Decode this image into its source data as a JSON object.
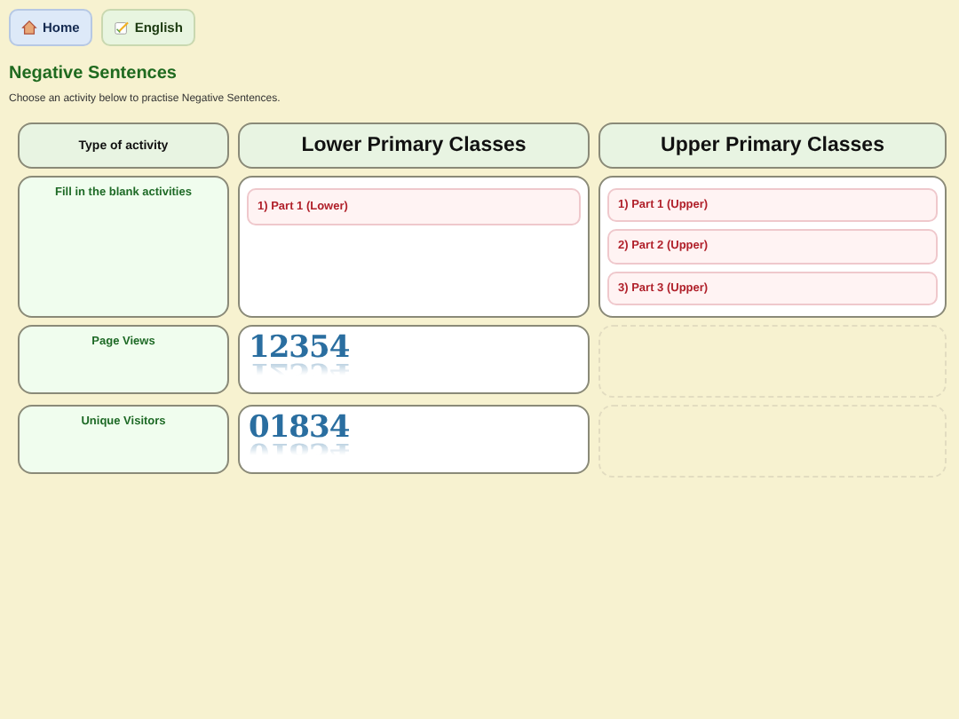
{
  "nav": [
    {
      "label": "Home",
      "kind": "home",
      "selected": true
    },
    {
      "label": "English",
      "kind": "pencil",
      "selected": false
    }
  ],
  "title": "Negative Sentences",
  "intro": "Choose an activity below to practise Negative Sentences.",
  "table": {
    "columns": [
      "Type of activity",
      "Lower Primary Classes",
      "Upper Primary Classes"
    ],
    "rows": [
      {
        "label": "Fill in the blank activities",
        "cells": [
          {
            "kind": "links",
            "links": [
              "1) Part 1 (Lower)"
            ]
          },
          {
            "kind": "links",
            "links": [
              "1) Part 1 (Upper)",
              "2) Part 2 (Upper)",
              "3) Part 3 (Upper)"
            ]
          }
        ]
      },
      {
        "label": "Page Views",
        "cells": [
          {
            "kind": "counter",
            "value": "12354"
          },
          {
            "kind": "empty"
          }
        ]
      },
      {
        "label": "Unique Visitors",
        "cells": [
          {
            "kind": "counter",
            "value": "01834"
          },
          {
            "kind": "empty"
          }
        ]
      }
    ]
  }
}
